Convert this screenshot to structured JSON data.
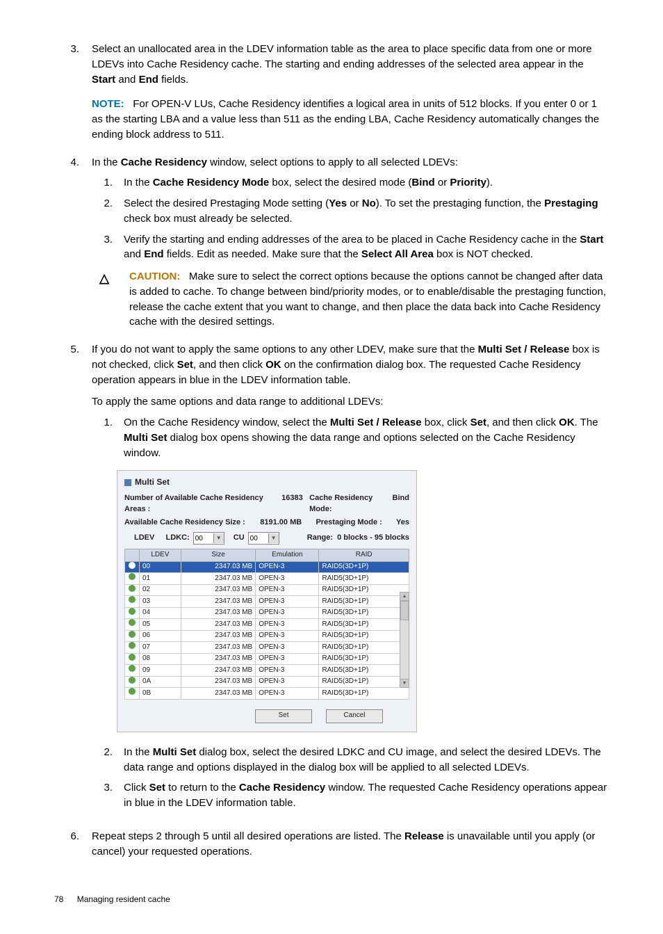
{
  "steps": {
    "s3": {
      "num": "3.",
      "text_a": "Select an unallocated area in the LDEV information table as the area to place specific data from one or more LDEVs into Cache Residency cache. The starting and ending addresses of the selected area appear in the ",
      "b1": "Start",
      "and": " and ",
      "b2": "End",
      "text_b": " fields."
    },
    "note": {
      "label": "NOTE:",
      "text": "For OPEN-V LUs, Cache Residency identifies a logical area in units of 512 blocks. If you enter 0 or 1 as the starting LBA and a value less than 511 as the ending LBA, Cache Residency automatically changes the ending block address to 511."
    },
    "s4": {
      "num": "4.",
      "text_a": "In the ",
      "b1": "Cache Residency",
      "text_b": " window, select options to apply to all selected LDEVs:",
      "sub1": {
        "n": "1.",
        "a": "In the ",
        "b1": "Cache Residency Mode",
        "b": " box, select the desired mode (",
        "b2": "Bind",
        "c": " or ",
        "b3": "Priority",
        "d": ")."
      },
      "sub2": {
        "n": "2.",
        "a": "Select the desired Prestaging Mode setting (",
        "b1": "Yes",
        "b": " or ",
        "b2": "No",
        "c": "). To set the prestaging function, the ",
        "b3": "Prestaging",
        "d": " check box must already be selected."
      },
      "sub3": {
        "n": "3.",
        "a": "Verify the starting and ending addresses of the area to be placed in Cache Residency cache in the ",
        "b1": "Start",
        "b": " and ",
        "b2": "End",
        "c": " fields. Edit as needed. Make sure that the ",
        "b3": "Select All Area",
        "d": " box is NOT checked."
      },
      "caution": {
        "icon": "△",
        "label": "CAUTION:",
        "text": "Make sure to select the correct options because the options cannot be changed after data is added to cache. To change between bind/priority modes, or to enable/disable the prestaging function, release the cache extent that you want to change, and then place the data back into Cache Residency cache with the desired settings."
      }
    },
    "s5": {
      "num": "5.",
      "a": "If you do not want to apply the same options to any other LDEV, make sure that the ",
      "b1": "Multi Set / Release",
      "b": " box is not checked, click ",
      "b2": "Set",
      "c": ", and then click ",
      "b3": "OK",
      "d": " on the confirmation dialog box. The requested Cache Residency operation appears in blue in the LDEV information table.",
      "apply": "To apply the same options and data range to additional LDEVs:",
      "sub1": {
        "n": "1.",
        "a": "On the Cache Residency window, select the ",
        "b1": "Multi Set / Release",
        "b": " box, click ",
        "b2": "Set",
        "c": ", and then click ",
        "b3": "OK",
        "d": ". The ",
        "b4": "Multi Set",
        "e": " dialog box opens showing the data range and options selected on the Cache Residency window."
      },
      "sub2": {
        "n": "2.",
        "a": "In the ",
        "b1": "Multi Set",
        "b": " dialog box, select the desired LDKC and CU image, and select the desired LDEVs. The data range and options displayed in the dialog box will be applied to all selected LDEVs."
      },
      "sub3": {
        "n": "3.",
        "a": "Click ",
        "b1": "Set",
        "b": " to return to the ",
        "b2": "Cache Residency",
        "c": " window. The requested Cache Residency operations appear in blue in the LDEV information table."
      }
    },
    "s6": {
      "num": "6.",
      "a": "Repeat steps 2 through 5 until all desired operations are listed. The ",
      "b1": "Release",
      "b": " is unavailable until you apply (or cancel) your requested operations."
    }
  },
  "dialog": {
    "title": "Multi Set",
    "areas_label": "Number of Available Cache Residency Areas :",
    "areas_value": "16383",
    "mode_label": "Cache Residency Mode:",
    "mode_value": "Bind",
    "size_label": "Available Cache Residency Size :",
    "size_value": "8191.00 MB",
    "prestage_label": "Prestaging Mode  :",
    "prestage_value": "Yes",
    "ldev_label": "LDEV",
    "ldkc_label": "LDKC:",
    "ldkc_value": "00",
    "cu_label": "CU",
    "cu_value": "00",
    "range_label": "Range:",
    "range_value": "0 blocks - 95 blocks",
    "cols": {
      "ldev": "LDEV",
      "size": "Size",
      "emul": "Emulation",
      "raid": "RAID"
    },
    "set_btn": "Set",
    "cancel_btn": "Cancel"
  },
  "chart_data": {
    "type": "table",
    "columns": [
      "LDEV",
      "Size",
      "Emulation",
      "RAID"
    ],
    "rows": [
      {
        "ldev": "00",
        "size": "2347.03 MB",
        "emul": "OPEN-3",
        "raid": "RAID5(3D+1P)",
        "selected": true
      },
      {
        "ldev": "01",
        "size": "2347.03 MB",
        "emul": "OPEN-3",
        "raid": "RAID5(3D+1P)"
      },
      {
        "ldev": "02",
        "size": "2347.03 MB",
        "emul": "OPEN-3",
        "raid": "RAID5(3D+1P)"
      },
      {
        "ldev": "03",
        "size": "2347.03 MB",
        "emul": "OPEN-3",
        "raid": "RAID5(3D+1P)"
      },
      {
        "ldev": "04",
        "size": "2347.03 MB",
        "emul": "OPEN-3",
        "raid": "RAID5(3D+1P)"
      },
      {
        "ldev": "05",
        "size": "2347.03 MB",
        "emul": "OPEN-3",
        "raid": "RAID5(3D+1P)"
      },
      {
        "ldev": "06",
        "size": "2347.03 MB",
        "emul": "OPEN-3",
        "raid": "RAID5(3D+1P)"
      },
      {
        "ldev": "07",
        "size": "2347.03 MB",
        "emul": "OPEN-3",
        "raid": "RAID5(3D+1P)"
      },
      {
        "ldev": "08",
        "size": "2347.03 MB",
        "emul": "OPEN-3",
        "raid": "RAID5(3D+1P)"
      },
      {
        "ldev": "09",
        "size": "2347.03 MB",
        "emul": "OPEN-3",
        "raid": "RAID5(3D+1P)"
      },
      {
        "ldev": "0A",
        "size": "2347.03 MB",
        "emul": "OPEN-3",
        "raid": "RAID5(3D+1P)"
      },
      {
        "ldev": "0B",
        "size": "2347.03 MB",
        "emul": "OPEN-3",
        "raid": "RAID5(3D+1P)"
      }
    ]
  },
  "footer": {
    "page": "78",
    "section": "Managing resident cache"
  }
}
